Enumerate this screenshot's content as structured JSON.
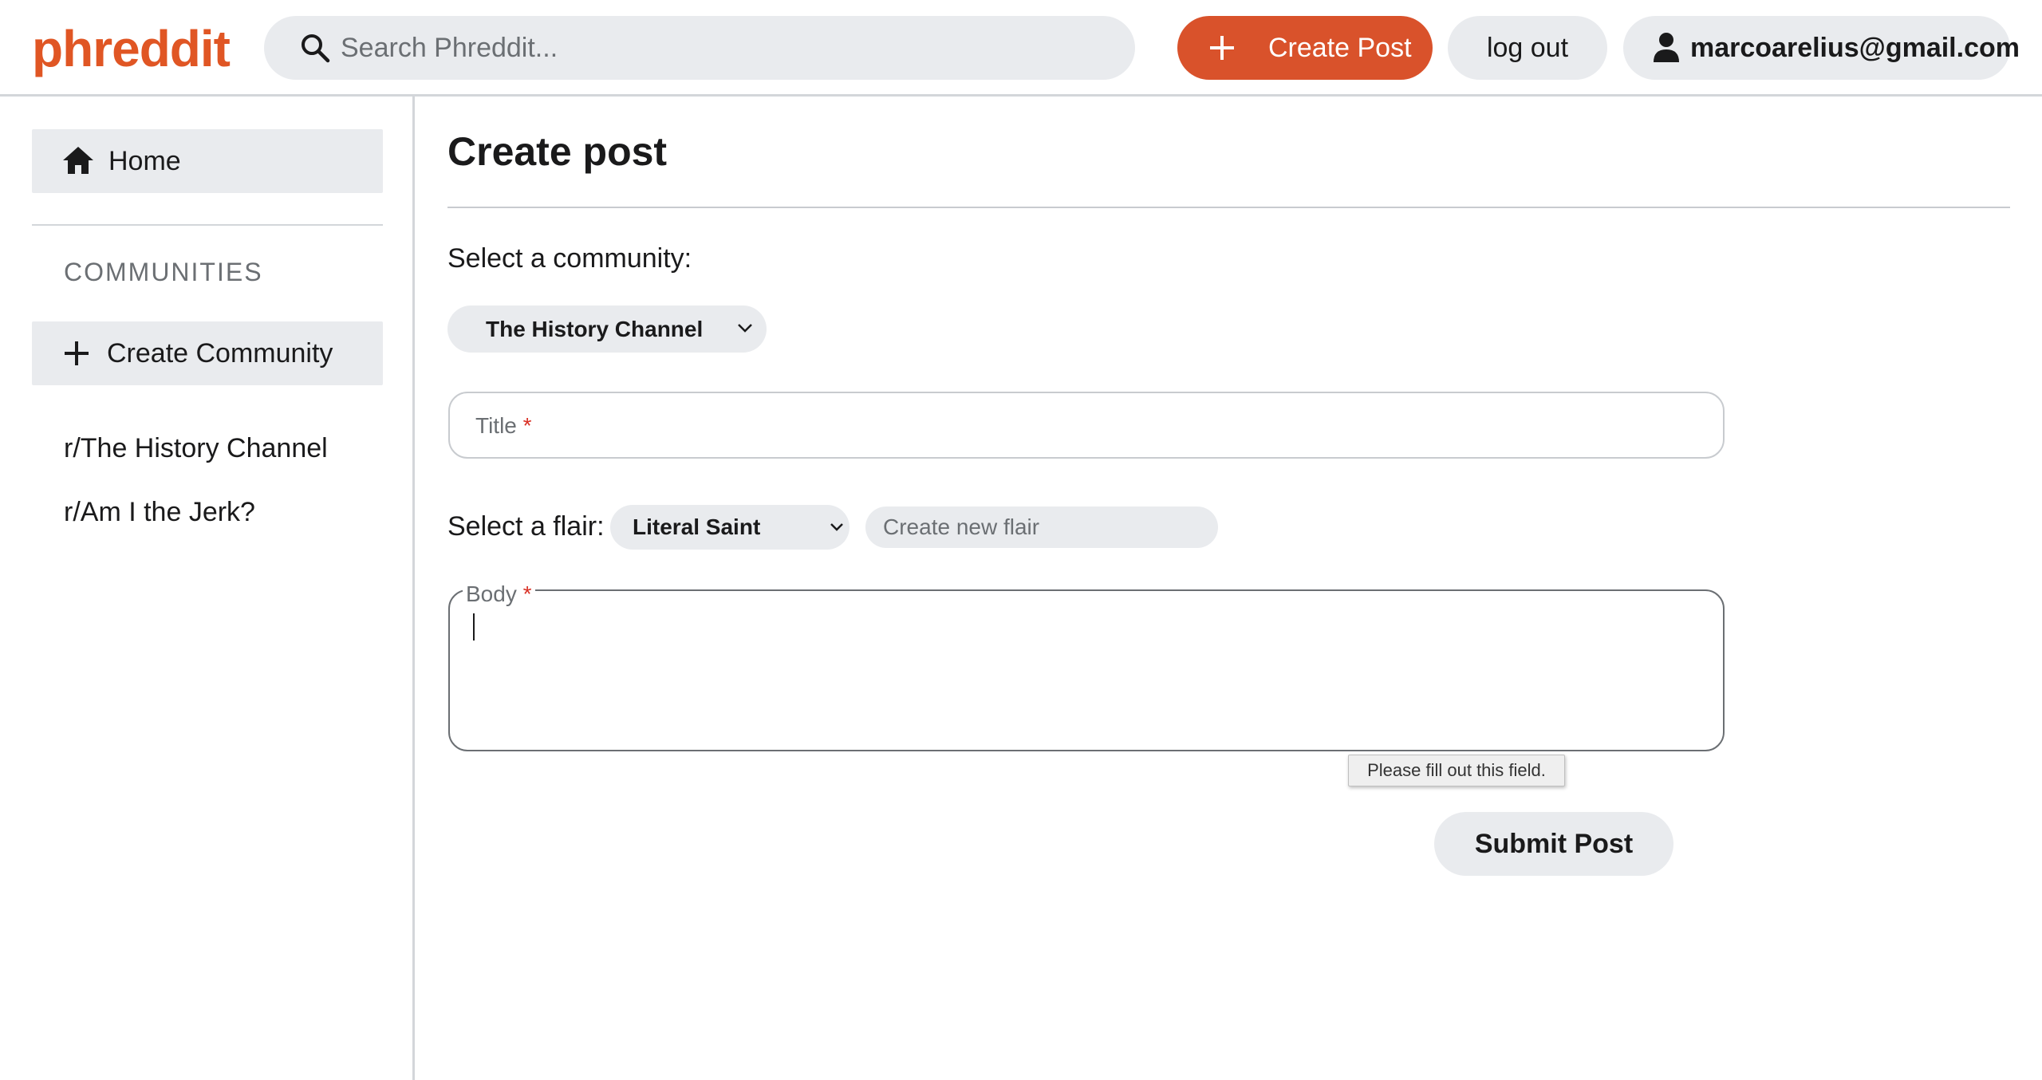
{
  "header": {
    "logo": "phreddit",
    "search_placeholder": "Search Phreddit...",
    "create_post_label": "Create Post",
    "logout_label": "log out",
    "user_email": "marcoarelius@gmail.com"
  },
  "sidebar": {
    "home_label": "Home",
    "communities_heading": "COMMUNITIES",
    "create_community_label": "Create Community",
    "communities": [
      "r/The History Channel",
      "r/Am I the Jerk?"
    ]
  },
  "form": {
    "page_title": "Create post",
    "community_label": "Select a community:",
    "community_selected": "The History Channel",
    "title_placeholder": "Title",
    "required_mark": "*",
    "flair_label": "Select a flair:",
    "flair_selected": "Literal Saint",
    "new_flair_placeholder": "Create new flair",
    "body_label": "Body",
    "validation_message": "Please fill out this field.",
    "submit_label": "Submit Post"
  },
  "colors": {
    "brand": "#e05624",
    "primary_button": "#d9522b",
    "pill_bg": "#e9ebee",
    "required": "#d93025"
  },
  "icons": {
    "search": "search-icon",
    "plus": "plus-icon",
    "user": "user-icon",
    "home": "home-icon",
    "chevron": "chevron-down-icon"
  }
}
